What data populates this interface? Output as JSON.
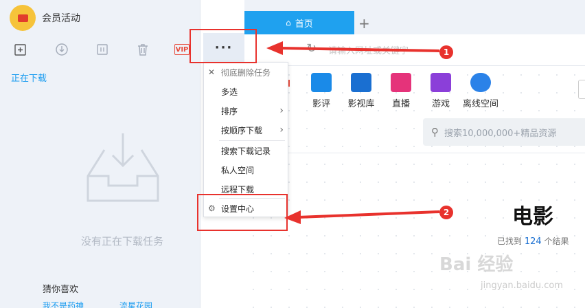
{
  "profile": {
    "name": "会员活动"
  },
  "toolbar": {
    "icons": [
      "new-task-icon",
      "download-icon",
      "pause-icon",
      "trash-icon"
    ],
    "vip_label": "VIP",
    "more_label": "···"
  },
  "left": {
    "tab_label": "正在下载",
    "empty_text": "没有正在下载任务",
    "guess_title": "猜你喜欢",
    "guess_links": [
      "我不是药神",
      "流星花园"
    ]
  },
  "browser": {
    "tab_home": "首页",
    "tab_add": "+",
    "address_placeholder": "请输入网址或关键字",
    "categories": [
      {
        "label": "影评",
        "icon": "film-review-icon",
        "color": "#1a8ae8"
      },
      {
        "label": "影视库",
        "icon": "video-library-icon",
        "color": "#1a6fd1"
      },
      {
        "label": "直播",
        "icon": "live-icon",
        "color": "#e5337a"
      },
      {
        "label": "游戏",
        "icon": "game-icon",
        "color": "#8b3fd9"
      },
      {
        "label": "离线空间",
        "icon": "cloud-icon",
        "color": "#2b82e8"
      }
    ],
    "search_placeholder": "搜索10,000,000+精品资源",
    "movie_title": "电影",
    "found_prefix": "已找到",
    "found_count": "124",
    "found_suffix": "个结果",
    "watermark": "Bai 经验",
    "watermark_url": "jingyan.baidu.com"
  },
  "menu": {
    "items": [
      {
        "label": "彻底删除任务",
        "icon": "close-icon",
        "submenu": false
      },
      {
        "label": "多选",
        "submenu": false
      },
      {
        "label": "排序",
        "submenu": true
      },
      {
        "label": "按顺序下载",
        "submenu": true
      },
      {
        "label": "搜索下载记录",
        "submenu": false
      },
      {
        "label": "私人空间",
        "submenu": false
      },
      {
        "label": "远程下载",
        "submenu": false
      },
      {
        "label": "设置中心",
        "icon": "gear-icon",
        "submenu": false
      }
    ]
  },
  "annotations": [
    {
      "number": "1"
    },
    {
      "number": "2"
    }
  ],
  "colors": {
    "accent": "#1fa1ef",
    "annotation": "#e8322d"
  }
}
